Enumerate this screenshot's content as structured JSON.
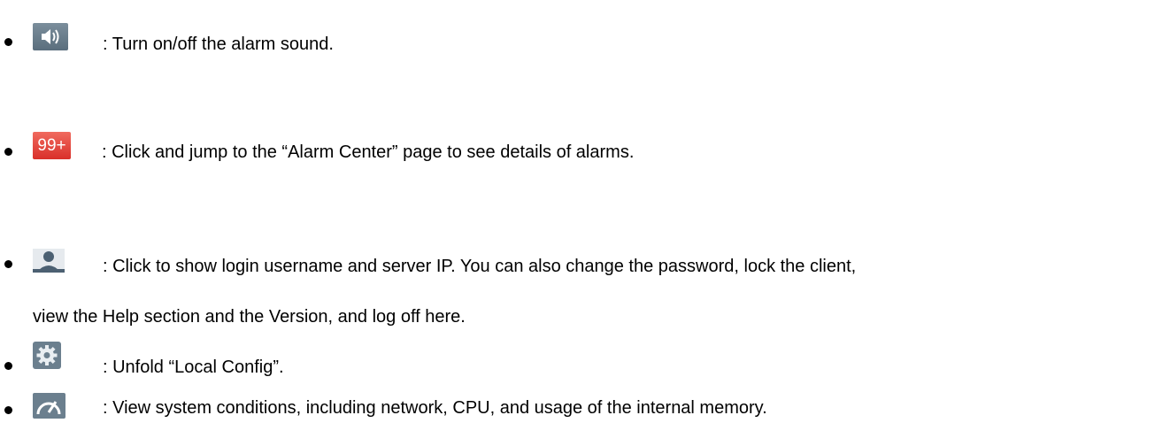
{
  "items": [
    {
      "icon": "speaker-icon",
      "text": ": Turn on/off the alarm sound."
    },
    {
      "icon": "alarm-count-badge",
      "badge_text": "99+",
      "text": ": Click and jump to the “Alarm Center” page to see details of alarms."
    },
    {
      "icon": "user-icon",
      "text": ": Click to show login username and server IP. You can also change the password, lock the client,",
      "continuation": "view the Help section and the Version, and log off here."
    },
    {
      "icon": "gear-icon",
      "text": ": Unfold “Local Config”."
    },
    {
      "icon": "gauge-icon",
      "text": ": View system conditions, including network, CPU, and usage of the internal memory."
    }
  ],
  "colors": {
    "badge_background": "#d9302a",
    "icon_gray": "#6b7f8e"
  }
}
